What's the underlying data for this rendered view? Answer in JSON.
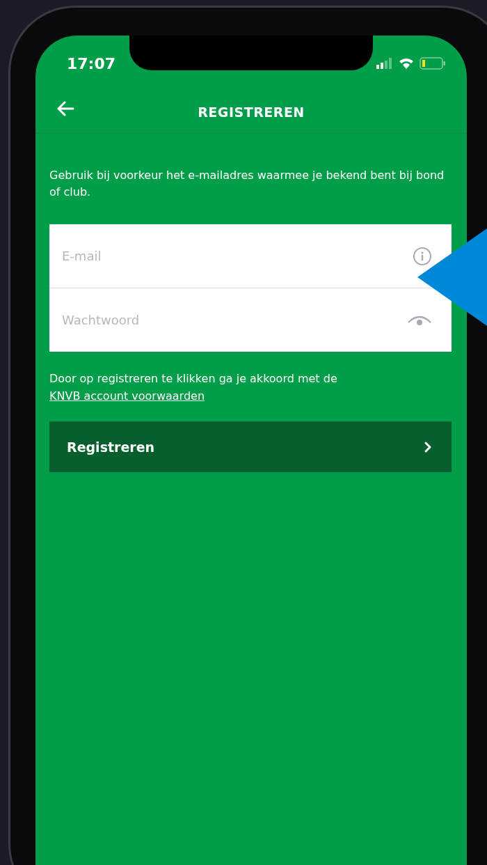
{
  "status_bar": {
    "time": "17:07"
  },
  "header": {
    "title": "REGISTREREN"
  },
  "intro": "Gebruik bij voorkeur het e-mailadres waarmee je bekend bent bij bond of club.",
  "fields": [
    {
      "kind": "email",
      "placeholder": "E-mail"
    },
    {
      "kind": "password",
      "placeholder": "Wachtwoord"
    }
  ],
  "terms": {
    "text": "Door op registreren te klikken ga je akkoord met de",
    "link": "KNVB account voorwaarden"
  },
  "submit_button": {
    "label": "Registreren"
  }
}
